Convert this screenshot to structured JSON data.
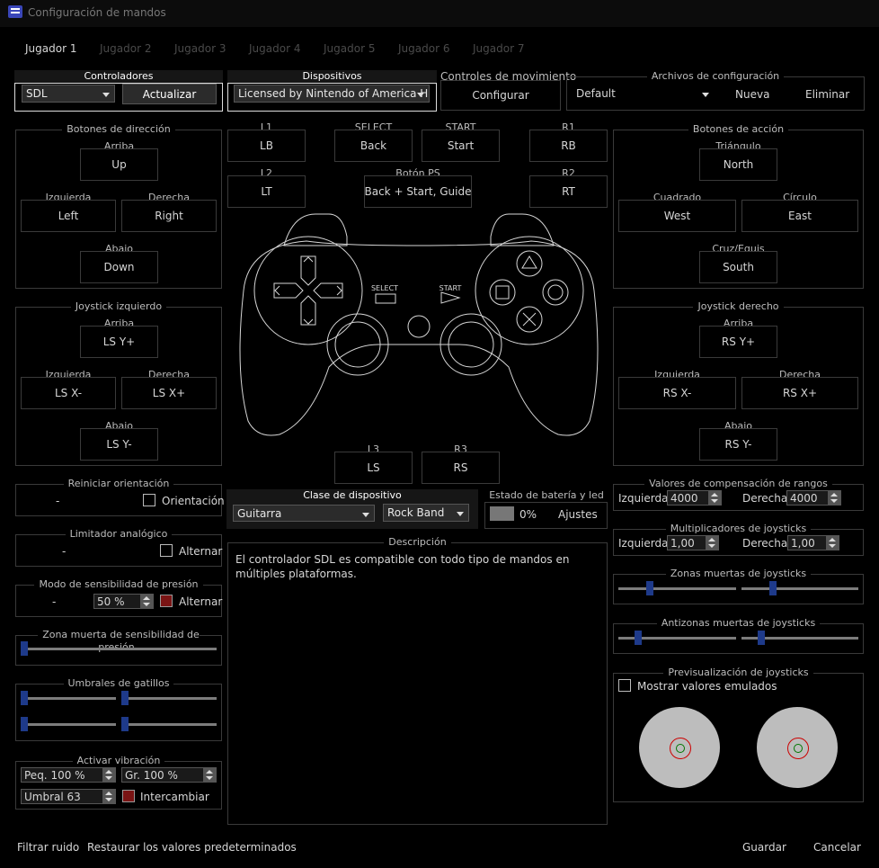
{
  "window": {
    "title": "Configuración de mandos"
  },
  "tabs": [
    "Jugador 1",
    "Jugador 2",
    "Jugador 3",
    "Jugador 4",
    "Jugador 5",
    "Jugador 6",
    "Jugador 7"
  ],
  "controladores": {
    "title": "Controladores",
    "value": "SDL",
    "refresh": "Actualizar"
  },
  "dispositivos": {
    "title": "Dispositivos",
    "value": "Licensed by Nintendo of America Har"
  },
  "movimiento": {
    "title": "Controles de movimiento",
    "button": "Configurar"
  },
  "archivos": {
    "title": "Archivos de configuración",
    "value": "Default",
    "new": "Nueva",
    "delete": "Eliminar"
  },
  "direccion": {
    "title": "Botones de dirección",
    "up_l": "Arriba",
    "up": "Up",
    "left_l": "Izquierda",
    "left": "Left",
    "right_l": "Derecha",
    "right": "Right",
    "down_l": "Abajo",
    "down": "Down"
  },
  "joy_izq": {
    "title": "Joystick izquierdo",
    "up_l": "Arriba",
    "up": "LS Y+",
    "left_l": "Izquierda",
    "left": "LS X-",
    "right_l": "Derecha",
    "right": "LS X+",
    "down_l": "Abajo",
    "down": "LS Y-"
  },
  "accion": {
    "title": "Botones de acción",
    "tri_l": "Triángulo",
    "tri": "North",
    "sq_l": "Cuadrado",
    "sq": "West",
    "ci_l": "Círculo",
    "ci": "East",
    "x_l": "Cruz/Equis",
    "x": "South"
  },
  "joy_der": {
    "title": "Joystick derecho",
    "up_l": "Arriba",
    "up": "RS Y+",
    "left_l": "Izquierda",
    "left": "RS X-",
    "right_l": "Derecha",
    "right": "RS X+",
    "down_l": "Abajo",
    "down": "RS Y-"
  },
  "center": {
    "l1_l": "L1",
    "l1": "LB",
    "select_l": "SELECT",
    "select": "Back",
    "start_l": "START",
    "start": "Start",
    "r1_l": "R1",
    "r1": "RB",
    "l2_l": "L2",
    "l2": "LT",
    "ps_l": "Botón PS",
    "ps": "Back + Start, Guide",
    "r2_l": "R2",
    "r2": "RT",
    "l3_l": "L3",
    "l3": "LS",
    "r3_l": "R3",
    "r3": "RS",
    "pad_select": "SELECT",
    "pad_start": "START"
  },
  "reiniciar": {
    "title": "Reiniciar orientación",
    "value": "-",
    "check": "Orientación"
  },
  "limitador": {
    "title": "Limitador analógico",
    "value": "-",
    "check": "Alternar"
  },
  "presion": {
    "title": "Modo de sensibilidad de presión",
    "value": "-",
    "spin": "50 %",
    "check": "Alternar"
  },
  "zona_presion": {
    "title": "Zona muerta de sensibilidad de presión",
    "level": 0.0
  },
  "umbrales": {
    "title": "Umbrales de gatillos",
    "levels": [
      0,
      0,
      0,
      0
    ]
  },
  "vibracion": {
    "title": "Activar vibración",
    "small": "Peq. 100 %",
    "large": "Gr. 100 %",
    "threshold": "Umbral 63",
    "swap": "Intercambiar"
  },
  "clase": {
    "title": "Clase de dispositivo",
    "type": "Guitarra",
    "subtype": "Rock Band"
  },
  "bateria": {
    "title": "Estado de batería y led",
    "percent": "0%",
    "settings": "Ajustes"
  },
  "descripcion": {
    "title": "Descripción",
    "text": "El controlador SDL es compatible con todo tipo de mandos en múltiples plataformas."
  },
  "rangos": {
    "title": "Valores de compensación de rangos",
    "left_l": "Izquierda",
    "left": "4000",
    "right_l": "Derecha",
    "right": "4000"
  },
  "multiplicadores": {
    "title": "Multiplicadores de joysticks",
    "left_l": "Izquierda",
    "left": "1,00",
    "right_l": "Derecha",
    "right": "1,00"
  },
  "zonas_muertas": {
    "title": "Zonas muertas de joysticks",
    "levels": [
      0.25,
      0.25
    ]
  },
  "antizonas": {
    "title": "Antizonas muertas de joysticks",
    "levels": [
      0.15,
      0.15
    ]
  },
  "preview": {
    "title": "Previsualización de joysticks",
    "check": "Mostrar valores emulados"
  },
  "footer": {
    "filter": "Filtrar ruido",
    "restore": "Restaurar los valores predeterminados",
    "save": "Guardar",
    "cancel": "Cancelar"
  },
  "colors": {
    "background": "#000000",
    "accent": "#1e3a8a",
    "border": "#3a3a3a",
    "toggle_red": "#7a1414"
  }
}
